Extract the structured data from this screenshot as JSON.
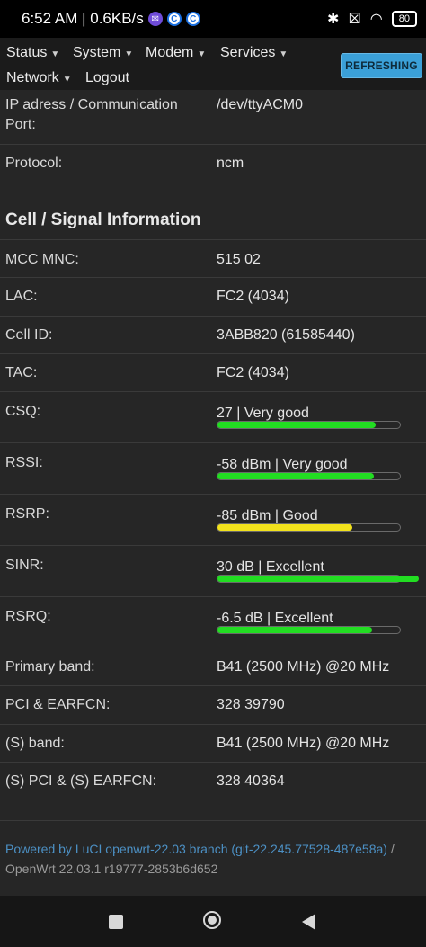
{
  "status_bar": {
    "time_speed": "6:52 AM | 0.6KB/s",
    "battery": "80"
  },
  "nav": {
    "status": "Status",
    "system": "System",
    "modem": "Modem",
    "services": "Services",
    "network": "Network",
    "logout": "Logout",
    "refresh": "REFRESHING"
  },
  "connection": {
    "port_label": "IP adress / Communication Port:",
    "port_value": "/dev/ttyACM0",
    "protocol_label": "Protocol:",
    "protocol_value": "ncm"
  },
  "section": {
    "title": "Cell / Signal Information"
  },
  "cell": {
    "mcc_label": "MCC MNC:",
    "mcc_value": "515 02",
    "lac_label": "LAC:",
    "lac_value": "FC2 (4034)",
    "cellid_label": "Cell ID:",
    "cellid_value": "3ABB820 (61585440)",
    "tac_label": "TAC:",
    "tac_value": "FC2 (4034)"
  },
  "signal": [
    {
      "label": "CSQ:",
      "value": "27 | Very good",
      "level": 0.86,
      "color": "#22dd22"
    },
    {
      "label": "RSSI:",
      "value": "-58 dBm | Very good",
      "level": 0.85,
      "color": "#22dd22"
    },
    {
      "label": "RSRP:",
      "value": "-85 dBm | Good",
      "level": 0.73,
      "color": "#f2e21c"
    },
    {
      "label": "SINR:",
      "value": "30 dB | Excellent",
      "level": 1.0,
      "color": "#22dd22"
    },
    {
      "label": "RSRQ:",
      "value": "-6.5 dB | Excellent",
      "level": 0.84,
      "color": "#22dd22"
    }
  ],
  "bands": {
    "primary_label": "Primary band:",
    "primary_value": "B41 (2500 MHz) @20 MHz",
    "pci_label": "PCI & EARFCN:",
    "pci_value": "328 39790",
    "sband_label": "(S) band:",
    "sband_value": "B41 (2500 MHz) @20 MHz",
    "spci_label": "(S) PCI & (S) EARFCN:",
    "spci_value": "328 40364"
  },
  "footer": {
    "powered": "Powered by LuCI openwrt-22.03 branch (git-22.245.77528-487e58a)",
    "sep": " /",
    "version": "OpenWrt 22.03.1 r19777-2853b6d652"
  }
}
